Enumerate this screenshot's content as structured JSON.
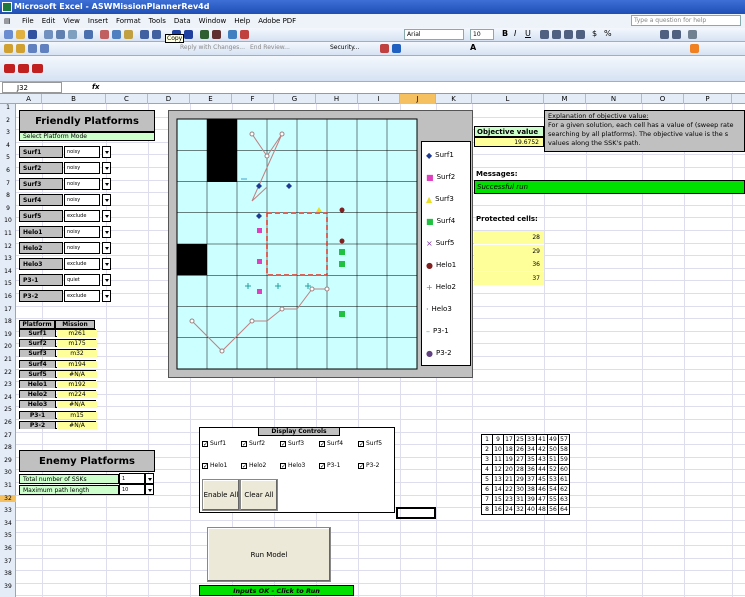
{
  "window": {
    "title": "Microsoft Excel - ASWMissionPlannerRev4d",
    "help_placeholder": "Type a question for help"
  },
  "menu": [
    "File",
    "Edit",
    "View",
    "Insert",
    "Format",
    "Tools",
    "Data",
    "Window",
    "Help",
    "Adobe PDF"
  ],
  "toolbar": {
    "tooltip": "Copy",
    "font_name": "Arial",
    "font_size": "10",
    "security_label": "Security...",
    "reply_label": "Reply with Changes...",
    "end_review": "End Review..."
  },
  "formula": {
    "namebox": "J32",
    "fx": "fx"
  },
  "columns": [
    "A",
    "B",
    "C",
    "D",
    "E",
    "F",
    "G",
    "H",
    "I",
    "J",
    "K",
    "L",
    "M",
    "N",
    "O",
    "P"
  ],
  "rows": [
    "1",
    "2",
    "3",
    "4",
    "5",
    "6",
    "7",
    "8",
    "9",
    "10",
    "11",
    "12",
    "13",
    "14",
    "15",
    "16",
    "17",
    "18",
    "19",
    "20",
    "21",
    "22",
    "23",
    "24",
    "25",
    "26",
    "27",
    "28",
    "29",
    "30",
    "31",
    "32",
    "33",
    "34",
    "35",
    "36",
    "37",
    "38",
    "39"
  ],
  "friendly": {
    "title": "Friendly Platforms",
    "mode_label": "Select Platform Mode",
    "platforms": [
      {
        "name": "Surf1",
        "mode": "noisy"
      },
      {
        "name": "Surf2",
        "mode": "noisy"
      },
      {
        "name": "Surf3",
        "mode": "noisy"
      },
      {
        "name": "Surf4",
        "mode": "noisy"
      },
      {
        "name": "Surf5",
        "mode": "exclude"
      },
      {
        "name": "Helo1",
        "mode": "noisy"
      },
      {
        "name": "Helo2",
        "mode": "noisy"
      },
      {
        "name": "Helo3",
        "mode": "exclude"
      },
      {
        "name": "P3-1",
        "mode": "quiet"
      },
      {
        "name": "P3-2",
        "mode": "exclude"
      }
    ]
  },
  "mission": {
    "col_platform": "Platform",
    "col_mission": "Mission",
    "rows": [
      {
        "p": "Surf1",
        "m": "m261"
      },
      {
        "p": "Surf2",
        "m": "m175"
      },
      {
        "p": "Surf3",
        "m": "m32"
      },
      {
        "p": "Surf4",
        "m": "m194"
      },
      {
        "p": "Surf5",
        "m": "#N/A"
      },
      {
        "p": "Helo1",
        "m": "m192"
      },
      {
        "p": "Helo2",
        "m": "m224"
      },
      {
        "p": "Helo3",
        "m": "#N/A"
      },
      {
        "p": "P3-1",
        "m": "m15"
      },
      {
        "p": "P3-2",
        "m": "#N/A"
      }
    ]
  },
  "enemy": {
    "title": "Enemy Platforms",
    "total_label": "Total number of SSKs",
    "total_value": "1",
    "path_label": "Maximum path length",
    "path_value": "10"
  },
  "objective": {
    "label": "Objective value",
    "value": "19.6752",
    "expl_title": "Explanation of objective value:",
    "expl_text": "For a given solution, each cell has a value of (sweep rate searching by all platforms). The objective value is the s values along the SSK's path."
  },
  "messages": {
    "label": "Messages:",
    "text": "Successful run"
  },
  "protected": {
    "label": "Protected cells:",
    "cells": [
      "28",
      "29",
      "36",
      "37"
    ]
  },
  "legend": [
    {
      "name": "Surf1",
      "symbol": "◆",
      "color": "#1f3a93"
    },
    {
      "name": "Surf2",
      "symbol": "■",
      "color": "#e040c0"
    },
    {
      "name": "Surf3",
      "symbol": "▲",
      "color": "#e8e020"
    },
    {
      "name": "Surf4",
      "symbol": "■",
      "color": "#20c040"
    },
    {
      "name": "Surf5",
      "symbol": "×",
      "color": "#8040a0"
    },
    {
      "name": "Helo1",
      "symbol": "●",
      "color": "#802020"
    },
    {
      "name": "Helo2",
      "symbol": "+",
      "color": "#20a0a0"
    },
    {
      "name": "Helo3",
      "symbol": "·",
      "color": "#3030a0"
    },
    {
      "name": "P3-1",
      "symbol": "–",
      "color": "#40a0d0"
    },
    {
      "name": "P3-2",
      "symbol": "●",
      "color": "#604080"
    }
  ],
  "display_controls": {
    "title": "Display Controls",
    "row1": [
      "Surf1",
      "Surf2",
      "Surf3",
      "Surf4",
      "Surf5"
    ],
    "row2": [
      "Helo1",
      "Helo2",
      "Helo3",
      "P3-1",
      "P3-2"
    ],
    "enable_all": "Enable All",
    "clear_all": "Clear All"
  },
  "run": {
    "button": "Run Model",
    "status": "Inputs OK - Click to Run"
  },
  "grid_numbers": [
    [
      1,
      9,
      17,
      25,
      33,
      41,
      49,
      57
    ],
    [
      2,
      10,
      18,
      26,
      34,
      42,
      50,
      58
    ],
    [
      3,
      11,
      19,
      27,
      35,
      43,
      51,
      59
    ],
    [
      4,
      12,
      20,
      28,
      36,
      44,
      52,
      60
    ],
    [
      5,
      13,
      21,
      29,
      37,
      45,
      53,
      61
    ],
    [
      6,
      14,
      22,
      30,
      38,
      46,
      54,
      62
    ],
    [
      7,
      15,
      23,
      31,
      39,
      47,
      55,
      63
    ],
    [
      8,
      16,
      24,
      32,
      40,
      48,
      56,
      64
    ]
  ]
}
